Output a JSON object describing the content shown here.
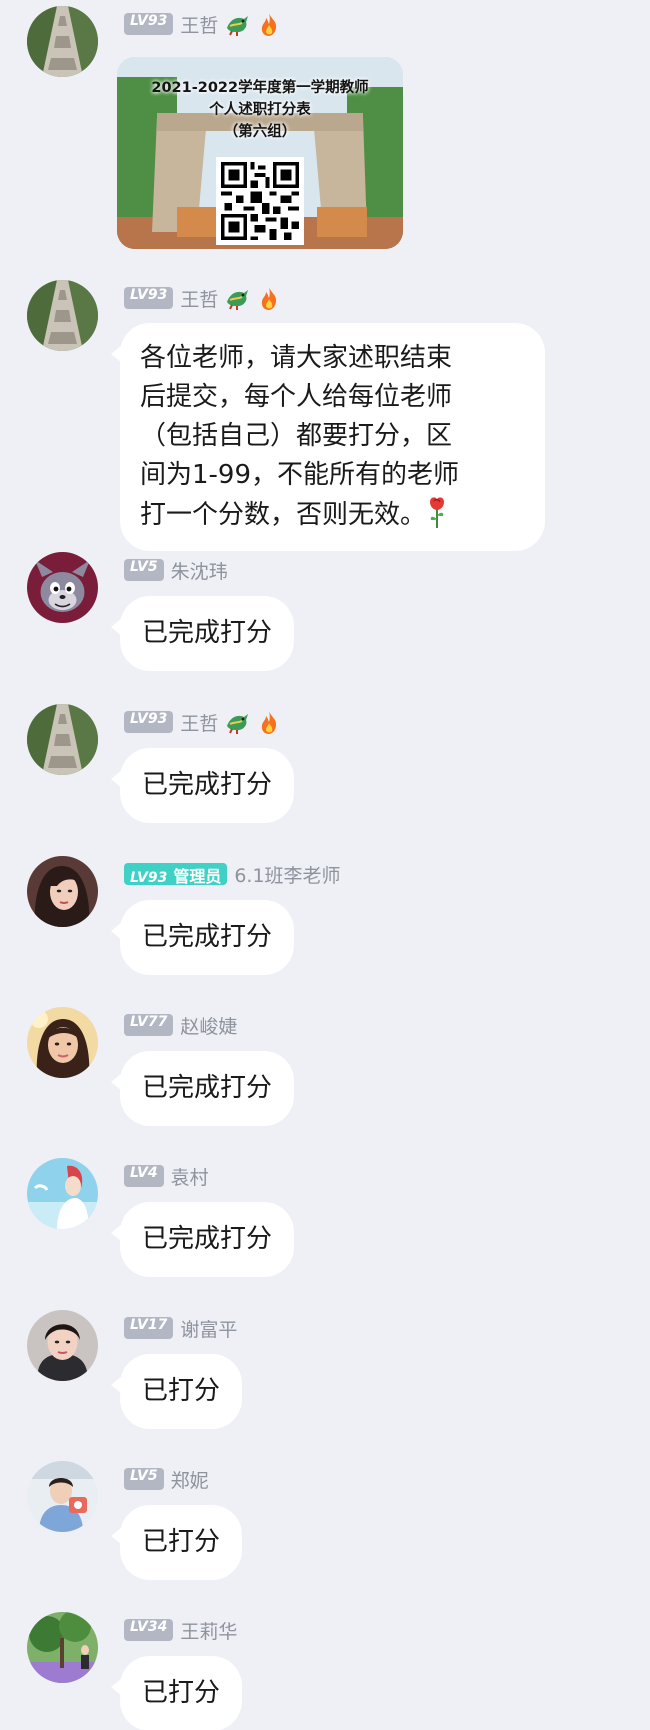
{
  "messages": [
    {
      "level": "LV93",
      "name": "王哲",
      "emojis": [
        "dragon",
        "fire"
      ],
      "type": "image",
      "poster": {
        "line1": "2021-2022学年度第一学期教师",
        "line2": "个人述职打分表",
        "line3": "（第六组）"
      }
    },
    {
      "level": "LV93",
      "name": "王哲",
      "emojis": [
        "dragon",
        "fire"
      ],
      "type": "text",
      "lines": [
        "各位老师，请大家述职结束",
        "后提交，每个人给每位老师",
        "（包括自己）都要打分，区",
        "间为1-99，不能所有的老师",
        "打一个分数，否则无效。"
      ],
      "trailing_emoji": "rose"
    },
    {
      "level": "LV5",
      "name": "朱沈玮",
      "type": "text",
      "text": "已完成打分"
    },
    {
      "level": "LV93",
      "name": "王哲",
      "emojis": [
        "dragon",
        "fire"
      ],
      "type": "text",
      "text": "已完成打分"
    },
    {
      "level": "LV93",
      "role": "管理员",
      "name": "6.1班李老师",
      "type": "text",
      "text": "已完成打分"
    },
    {
      "level": "LV77",
      "name": "赵峻婕",
      "type": "text",
      "text": "已完成打分"
    },
    {
      "level": "LV4",
      "name": "袁村",
      "type": "text",
      "text": "已完成打分"
    },
    {
      "level": "LV17",
      "name": "谢富平",
      "type": "text",
      "text": "已打分"
    },
    {
      "level": "LV5",
      "name": "郑妮",
      "type": "text",
      "text": "已打分"
    },
    {
      "level": "LV34",
      "name": "王莉华",
      "type": "text",
      "text": "已打分"
    }
  ],
  "colors": {
    "background": "#eef0f6",
    "bubble": "#ffffff",
    "level_badge": "#b3b7c3",
    "admin_badge": "#3fd0c6",
    "name": "#8f939d"
  }
}
